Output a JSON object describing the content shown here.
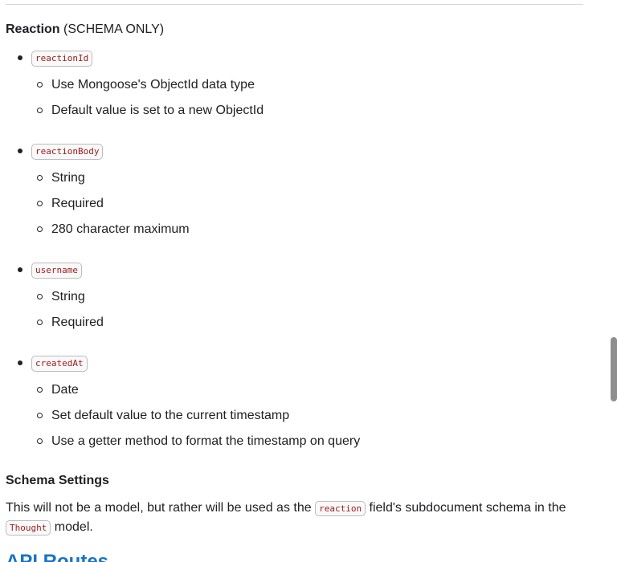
{
  "reaction_section": {
    "title_bold": "Reaction",
    "title_rest": " (SCHEMA ONLY)"
  },
  "fields": [
    {
      "name": "reactionId",
      "details": [
        "Use Mongoose's ObjectId data type",
        "Default value is set to a new ObjectId"
      ]
    },
    {
      "name": "reactionBody",
      "details": [
        "String",
        "Required",
        "280 character maximum"
      ]
    },
    {
      "name": "username",
      "details": [
        "String",
        "Required"
      ]
    },
    {
      "name": "createdAt",
      "details": [
        "Date",
        "Set default value to the current timestamp",
        "Use a getter method to format the timestamp on query"
      ]
    }
  ],
  "settings": {
    "title": "Schema Settings",
    "para_part1": "This will not be a model, but rather will be used as the ",
    "code1": "reaction",
    "para_part2": " field's subdocument schema in the",
    "code2": "Thought",
    "para_part3": " model."
  },
  "next_heading": "API Routes"
}
